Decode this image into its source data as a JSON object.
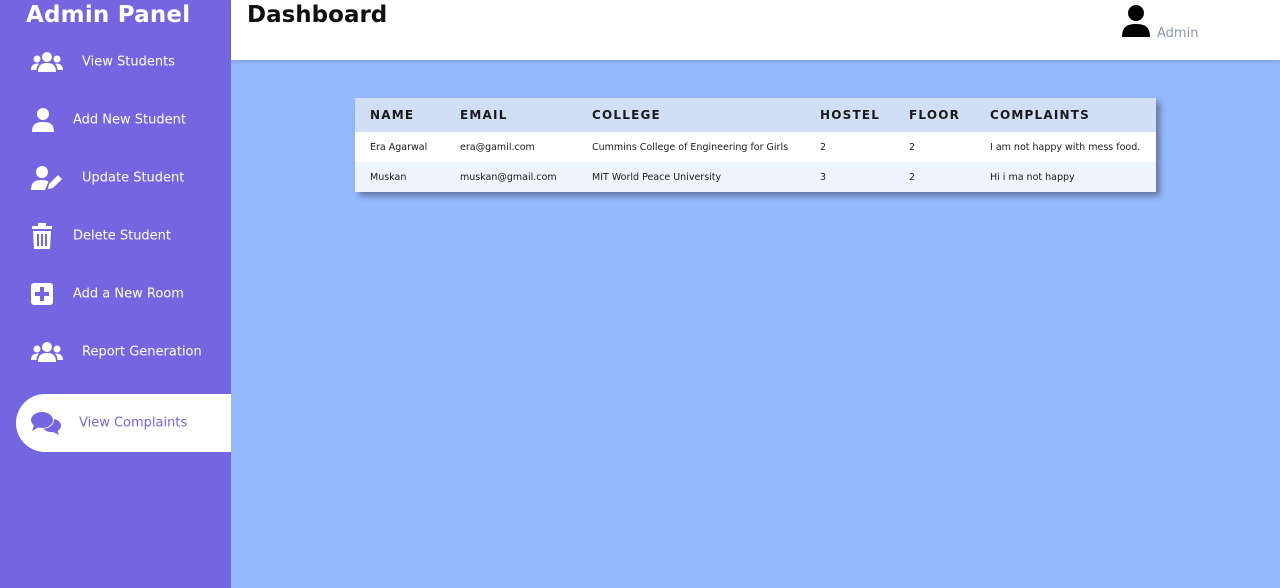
{
  "sidebar": {
    "title": "Admin Panel",
    "items": [
      {
        "label": "View Students",
        "icon": "users-icon"
      },
      {
        "label": "Add New Student",
        "icon": "user-icon"
      },
      {
        "label": "Update Student",
        "icon": "user-edit-icon"
      },
      {
        "label": "Delete Student",
        "icon": "trash-icon"
      },
      {
        "label": "Add a New Room",
        "icon": "plus-square-icon"
      },
      {
        "label": "Report Generation",
        "icon": "users-icon"
      },
      {
        "label": "View Complaints",
        "icon": "comments-icon",
        "active": true
      }
    ]
  },
  "header": {
    "title": "Dashboard",
    "user": "Admin"
  },
  "table": {
    "columns": [
      "NAME",
      "EMAIL",
      "COLLEGE",
      "HOSTEL",
      "FLOOR",
      "COMPLAINTS"
    ],
    "rows": [
      [
        "Era Agarwal",
        "era@gamil.com",
        "Cummins College of Engineering for Girls",
        "2",
        "2",
        "I am not happy with mess food."
      ],
      [
        "Muskan",
        "muskan@gmail.com",
        "MIT World Peace University",
        "3",
        "2",
        "Hi i ma not happy"
      ]
    ]
  },
  "colors": {
    "sidebar": "#7466e1",
    "content_bg": "#96b8fd",
    "table_header": "#d0dff5",
    "active_text": "#7466e1"
  }
}
